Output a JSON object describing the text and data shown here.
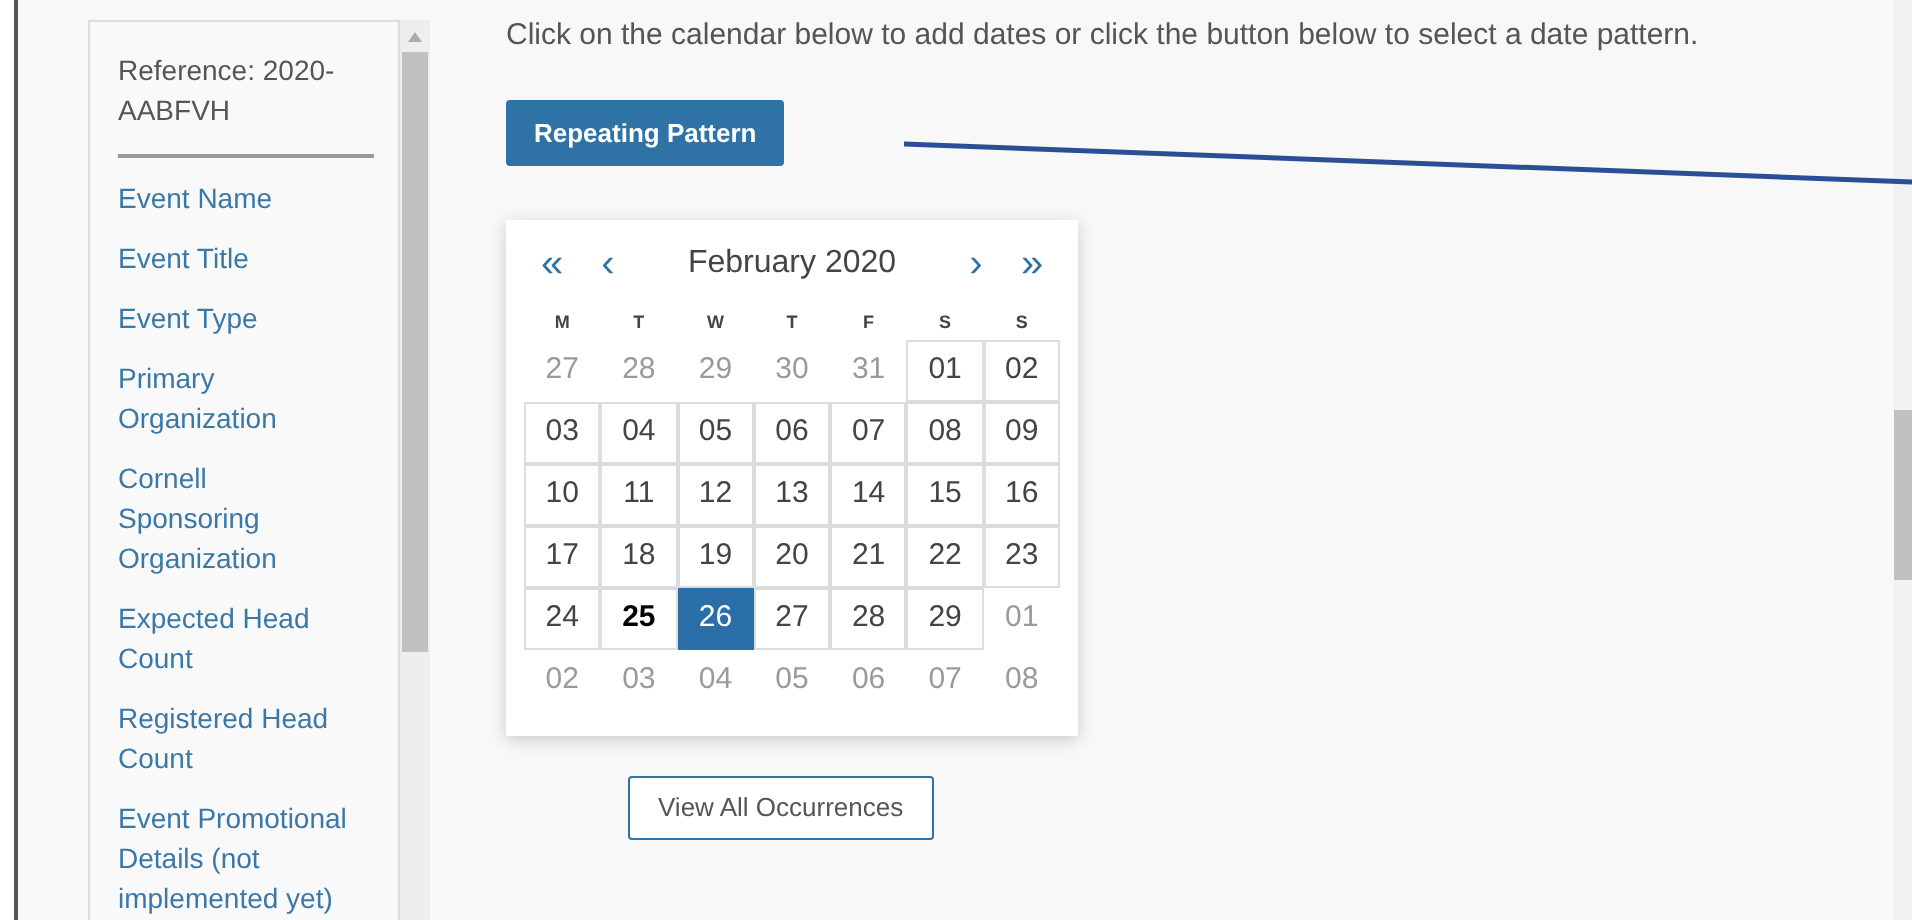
{
  "sidebar": {
    "reference": "Reference: 2020-AABFVH",
    "items": [
      "Event Name",
      "Event Title",
      "Event Type",
      "Primary Organization",
      "Cornell Sponsoring Organization",
      "Expected Head Count",
      "Registered Head Count",
      "Event Promotional Details (not implemented yet)"
    ]
  },
  "instructions": "Click on the calendar below to add dates or click the button below to select a date pattern.",
  "pattern_button": "Repeating Pattern",
  "calendar": {
    "first": "«",
    "prev": "‹",
    "month": "February 2020",
    "next": "›",
    "last": "»",
    "weekdays": [
      "M",
      "T",
      "W",
      "T",
      "F",
      "S",
      "S"
    ],
    "days": [
      {
        "text": "27",
        "in_month": false,
        "selected": false,
        "today": false
      },
      {
        "text": "28",
        "in_month": false,
        "selected": false,
        "today": false
      },
      {
        "text": "29",
        "in_month": false,
        "selected": false,
        "today": false
      },
      {
        "text": "30",
        "in_month": false,
        "selected": false,
        "today": false
      },
      {
        "text": "31",
        "in_month": false,
        "selected": false,
        "today": false
      },
      {
        "text": "01",
        "in_month": true,
        "selected": false,
        "today": false
      },
      {
        "text": "02",
        "in_month": true,
        "selected": false,
        "today": false
      },
      {
        "text": "03",
        "in_month": true,
        "selected": false,
        "today": false
      },
      {
        "text": "04",
        "in_month": true,
        "selected": false,
        "today": false
      },
      {
        "text": "05",
        "in_month": true,
        "selected": false,
        "today": false
      },
      {
        "text": "06",
        "in_month": true,
        "selected": false,
        "today": false
      },
      {
        "text": "07",
        "in_month": true,
        "selected": false,
        "today": false
      },
      {
        "text": "08",
        "in_month": true,
        "selected": false,
        "today": false
      },
      {
        "text": "09",
        "in_month": true,
        "selected": false,
        "today": false
      },
      {
        "text": "10",
        "in_month": true,
        "selected": false,
        "today": false
      },
      {
        "text": "11",
        "in_month": true,
        "selected": false,
        "today": false
      },
      {
        "text": "12",
        "in_month": true,
        "selected": false,
        "today": false
      },
      {
        "text": "13",
        "in_month": true,
        "selected": false,
        "today": false
      },
      {
        "text": "14",
        "in_month": true,
        "selected": false,
        "today": false
      },
      {
        "text": "15",
        "in_month": true,
        "selected": false,
        "today": false
      },
      {
        "text": "16",
        "in_month": true,
        "selected": false,
        "today": false
      },
      {
        "text": "17",
        "in_month": true,
        "selected": false,
        "today": false
      },
      {
        "text": "18",
        "in_month": true,
        "selected": false,
        "today": false
      },
      {
        "text": "19",
        "in_month": true,
        "selected": false,
        "today": false
      },
      {
        "text": "20",
        "in_month": true,
        "selected": false,
        "today": false
      },
      {
        "text": "21",
        "in_month": true,
        "selected": false,
        "today": false
      },
      {
        "text": "22",
        "in_month": true,
        "selected": false,
        "today": false
      },
      {
        "text": "23",
        "in_month": true,
        "selected": false,
        "today": false
      },
      {
        "text": "24",
        "in_month": true,
        "selected": false,
        "today": false
      },
      {
        "text": "25",
        "in_month": true,
        "selected": false,
        "today": true
      },
      {
        "text": "26",
        "in_month": true,
        "selected": true,
        "today": false
      },
      {
        "text": "27",
        "in_month": true,
        "selected": false,
        "today": false
      },
      {
        "text": "28",
        "in_month": true,
        "selected": false,
        "today": false
      },
      {
        "text": "29",
        "in_month": true,
        "selected": false,
        "today": false
      },
      {
        "text": "01",
        "in_month": false,
        "selected": false,
        "today": false
      },
      {
        "text": "02",
        "in_month": false,
        "selected": false,
        "today": false
      },
      {
        "text": "03",
        "in_month": false,
        "selected": false,
        "today": false
      },
      {
        "text": "04",
        "in_month": false,
        "selected": false,
        "today": false
      },
      {
        "text": "05",
        "in_month": false,
        "selected": false,
        "today": false
      },
      {
        "text": "06",
        "in_month": false,
        "selected": false,
        "today": false
      },
      {
        "text": "07",
        "in_month": false,
        "selected": false,
        "today": false
      },
      {
        "text": "08",
        "in_month": false,
        "selected": false,
        "today": false
      }
    ]
  },
  "occurrences_button": "View All Occurrences"
}
